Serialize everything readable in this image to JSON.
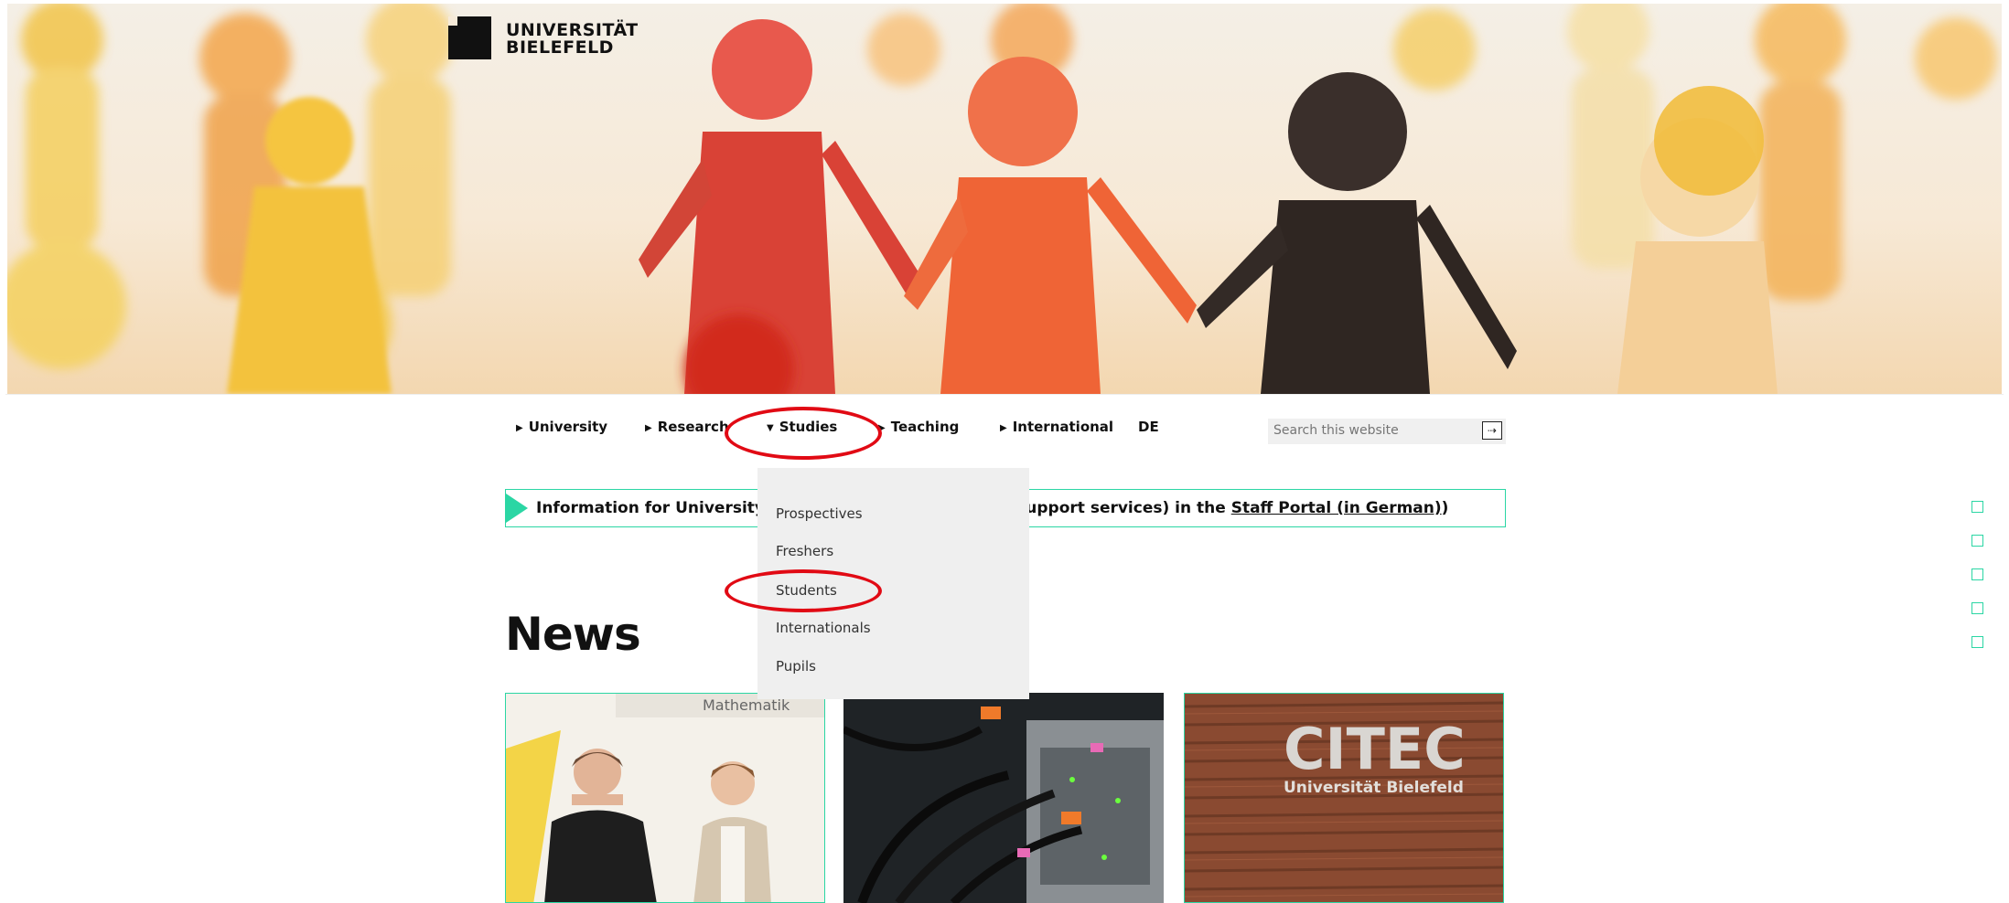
{
  "logo": {
    "line1": "UNIVERSITÄT",
    "line2": "BIELEFELD"
  },
  "nav": {
    "items": [
      {
        "label": "University",
        "marker": "▶"
      },
      {
        "label": "Research",
        "marker": "▶"
      },
      {
        "label": "Studies",
        "marker": "▼"
      },
      {
        "label": "Teaching",
        "marker": "▶"
      },
      {
        "label": "International",
        "marker": "▶"
      },
      {
        "label": "DE",
        "marker": ""
      }
    ]
  },
  "search": {
    "placeholder": "Search this website",
    "button_icon": "⇢"
  },
  "notice": {
    "text_start": "Information for University st",
    "text_end": "support services) in the ",
    "link": "Staff Portal (in German)",
    "text_close": ")"
  },
  "dropdown": {
    "items": [
      "Prospectives",
      "Freshers",
      "Students",
      "Internationals",
      "Pupils"
    ]
  },
  "news": {
    "title": "News",
    "cards": [
      {
        "image_text": "Mathematik"
      },
      {
        "image_text": ""
      },
      {
        "image_text": "CITEC",
        "image_subtext": "Universität Bielefeld"
      }
    ]
  },
  "colors": {
    "accent": "#2bd6a4",
    "highlight": "#e10a14"
  }
}
